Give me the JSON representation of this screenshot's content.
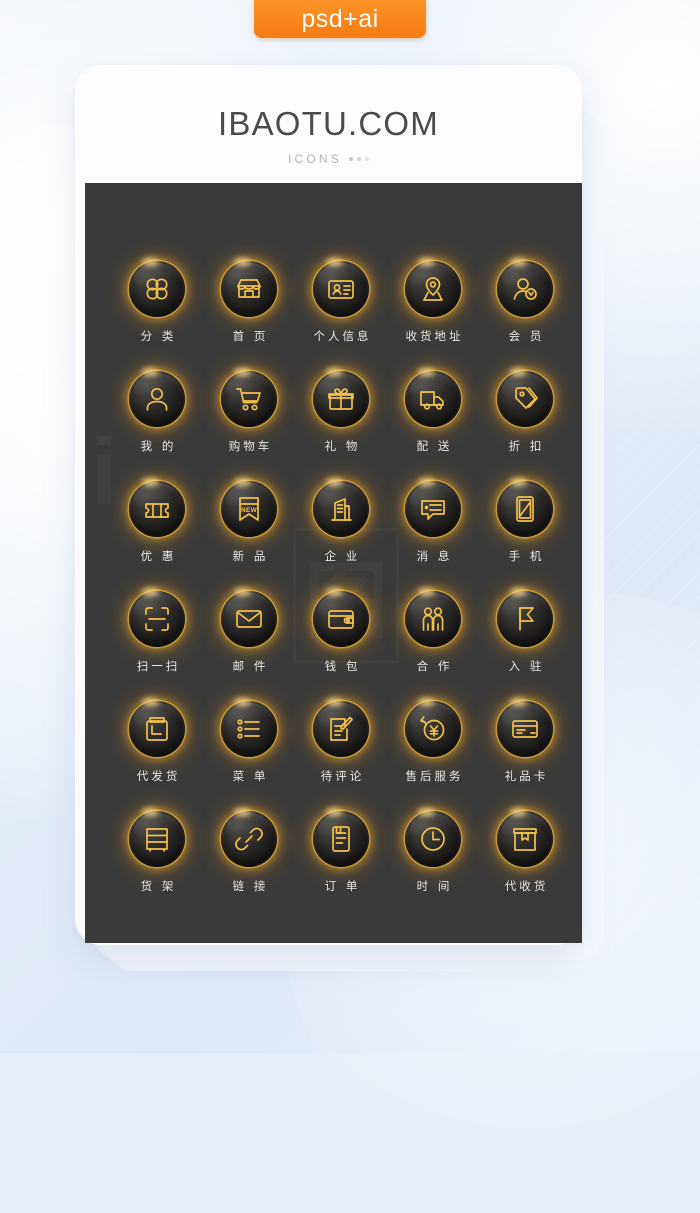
{
  "badge": {
    "label": "psd+ai",
    "color": "#f57c10"
  },
  "brand": {
    "title": "IBAOTU.COM",
    "subtitle": "ICONS"
  },
  "panel": {
    "background": "#3a3a3a",
    "icon_accent": "#f3c04a",
    "glow": "#f39e18",
    "watermark_1": "i",
    "watermark_2": "图"
  },
  "icons": [
    {
      "label": "分 类",
      "name": "category-icon",
      "glyph": "clover"
    },
    {
      "label": "首 页",
      "name": "home-shop-icon",
      "glyph": "shop"
    },
    {
      "label": "个人信息",
      "name": "profile-card-icon",
      "glyph": "idcard"
    },
    {
      "label": "收货地址",
      "name": "address-pin-icon",
      "glyph": "pin"
    },
    {
      "label": "会 员",
      "name": "member-icon",
      "glyph": "member"
    },
    {
      "label": "我 的",
      "name": "user-mine-icon",
      "glyph": "user"
    },
    {
      "label": "购物车",
      "name": "shopping-cart-icon",
      "glyph": "cart"
    },
    {
      "label": "礼 物",
      "name": "gift-icon",
      "glyph": "gift"
    },
    {
      "label": "配 送",
      "name": "delivery-truck-icon",
      "glyph": "truck"
    },
    {
      "label": "折 扣",
      "name": "discount-tag-icon",
      "glyph": "tags"
    },
    {
      "label": "优 惠",
      "name": "coupon-ticket-icon",
      "glyph": "ticket"
    },
    {
      "label": "新 品",
      "name": "new-product-icon",
      "glyph": "newbanner",
      "badge_text": "NEW"
    },
    {
      "label": "企 业",
      "name": "enterprise-icon",
      "glyph": "building"
    },
    {
      "label": "消 息",
      "name": "message-icon",
      "glyph": "message"
    },
    {
      "label": "手 机",
      "name": "mobile-phone-icon",
      "glyph": "phone"
    },
    {
      "label": "扫一扫",
      "name": "scan-qr-icon",
      "glyph": "scan"
    },
    {
      "label": "邮 件",
      "name": "mail-envelope-icon",
      "glyph": "mail"
    },
    {
      "label": "钱 包",
      "name": "wallet-icon",
      "glyph": "wallet"
    },
    {
      "label": "合 作",
      "name": "cooperation-icon",
      "glyph": "twopeople"
    },
    {
      "label": "入 驻",
      "name": "settle-in-flag-icon",
      "glyph": "flag"
    },
    {
      "label": "代发货",
      "name": "pending-shipment-icon",
      "glyph": "dropship"
    },
    {
      "label": "菜 单",
      "name": "menu-list-icon",
      "glyph": "list"
    },
    {
      "label": "待评论",
      "name": "pending-review-icon",
      "glyph": "review"
    },
    {
      "label": "售后服务",
      "name": "after-sales-icon",
      "glyph": "refund"
    },
    {
      "label": "礼品卡",
      "name": "gift-card-icon",
      "glyph": "giftcard"
    },
    {
      "label": "货 架",
      "name": "shelf-icon",
      "glyph": "shelf"
    },
    {
      "label": "链 接",
      "name": "link-icon",
      "glyph": "link"
    },
    {
      "label": "订 单",
      "name": "order-icon",
      "glyph": "order"
    },
    {
      "label": "时 间",
      "name": "time-clock-icon",
      "glyph": "clock"
    },
    {
      "label": "代收货",
      "name": "pending-receipt-icon",
      "glyph": "box"
    }
  ]
}
